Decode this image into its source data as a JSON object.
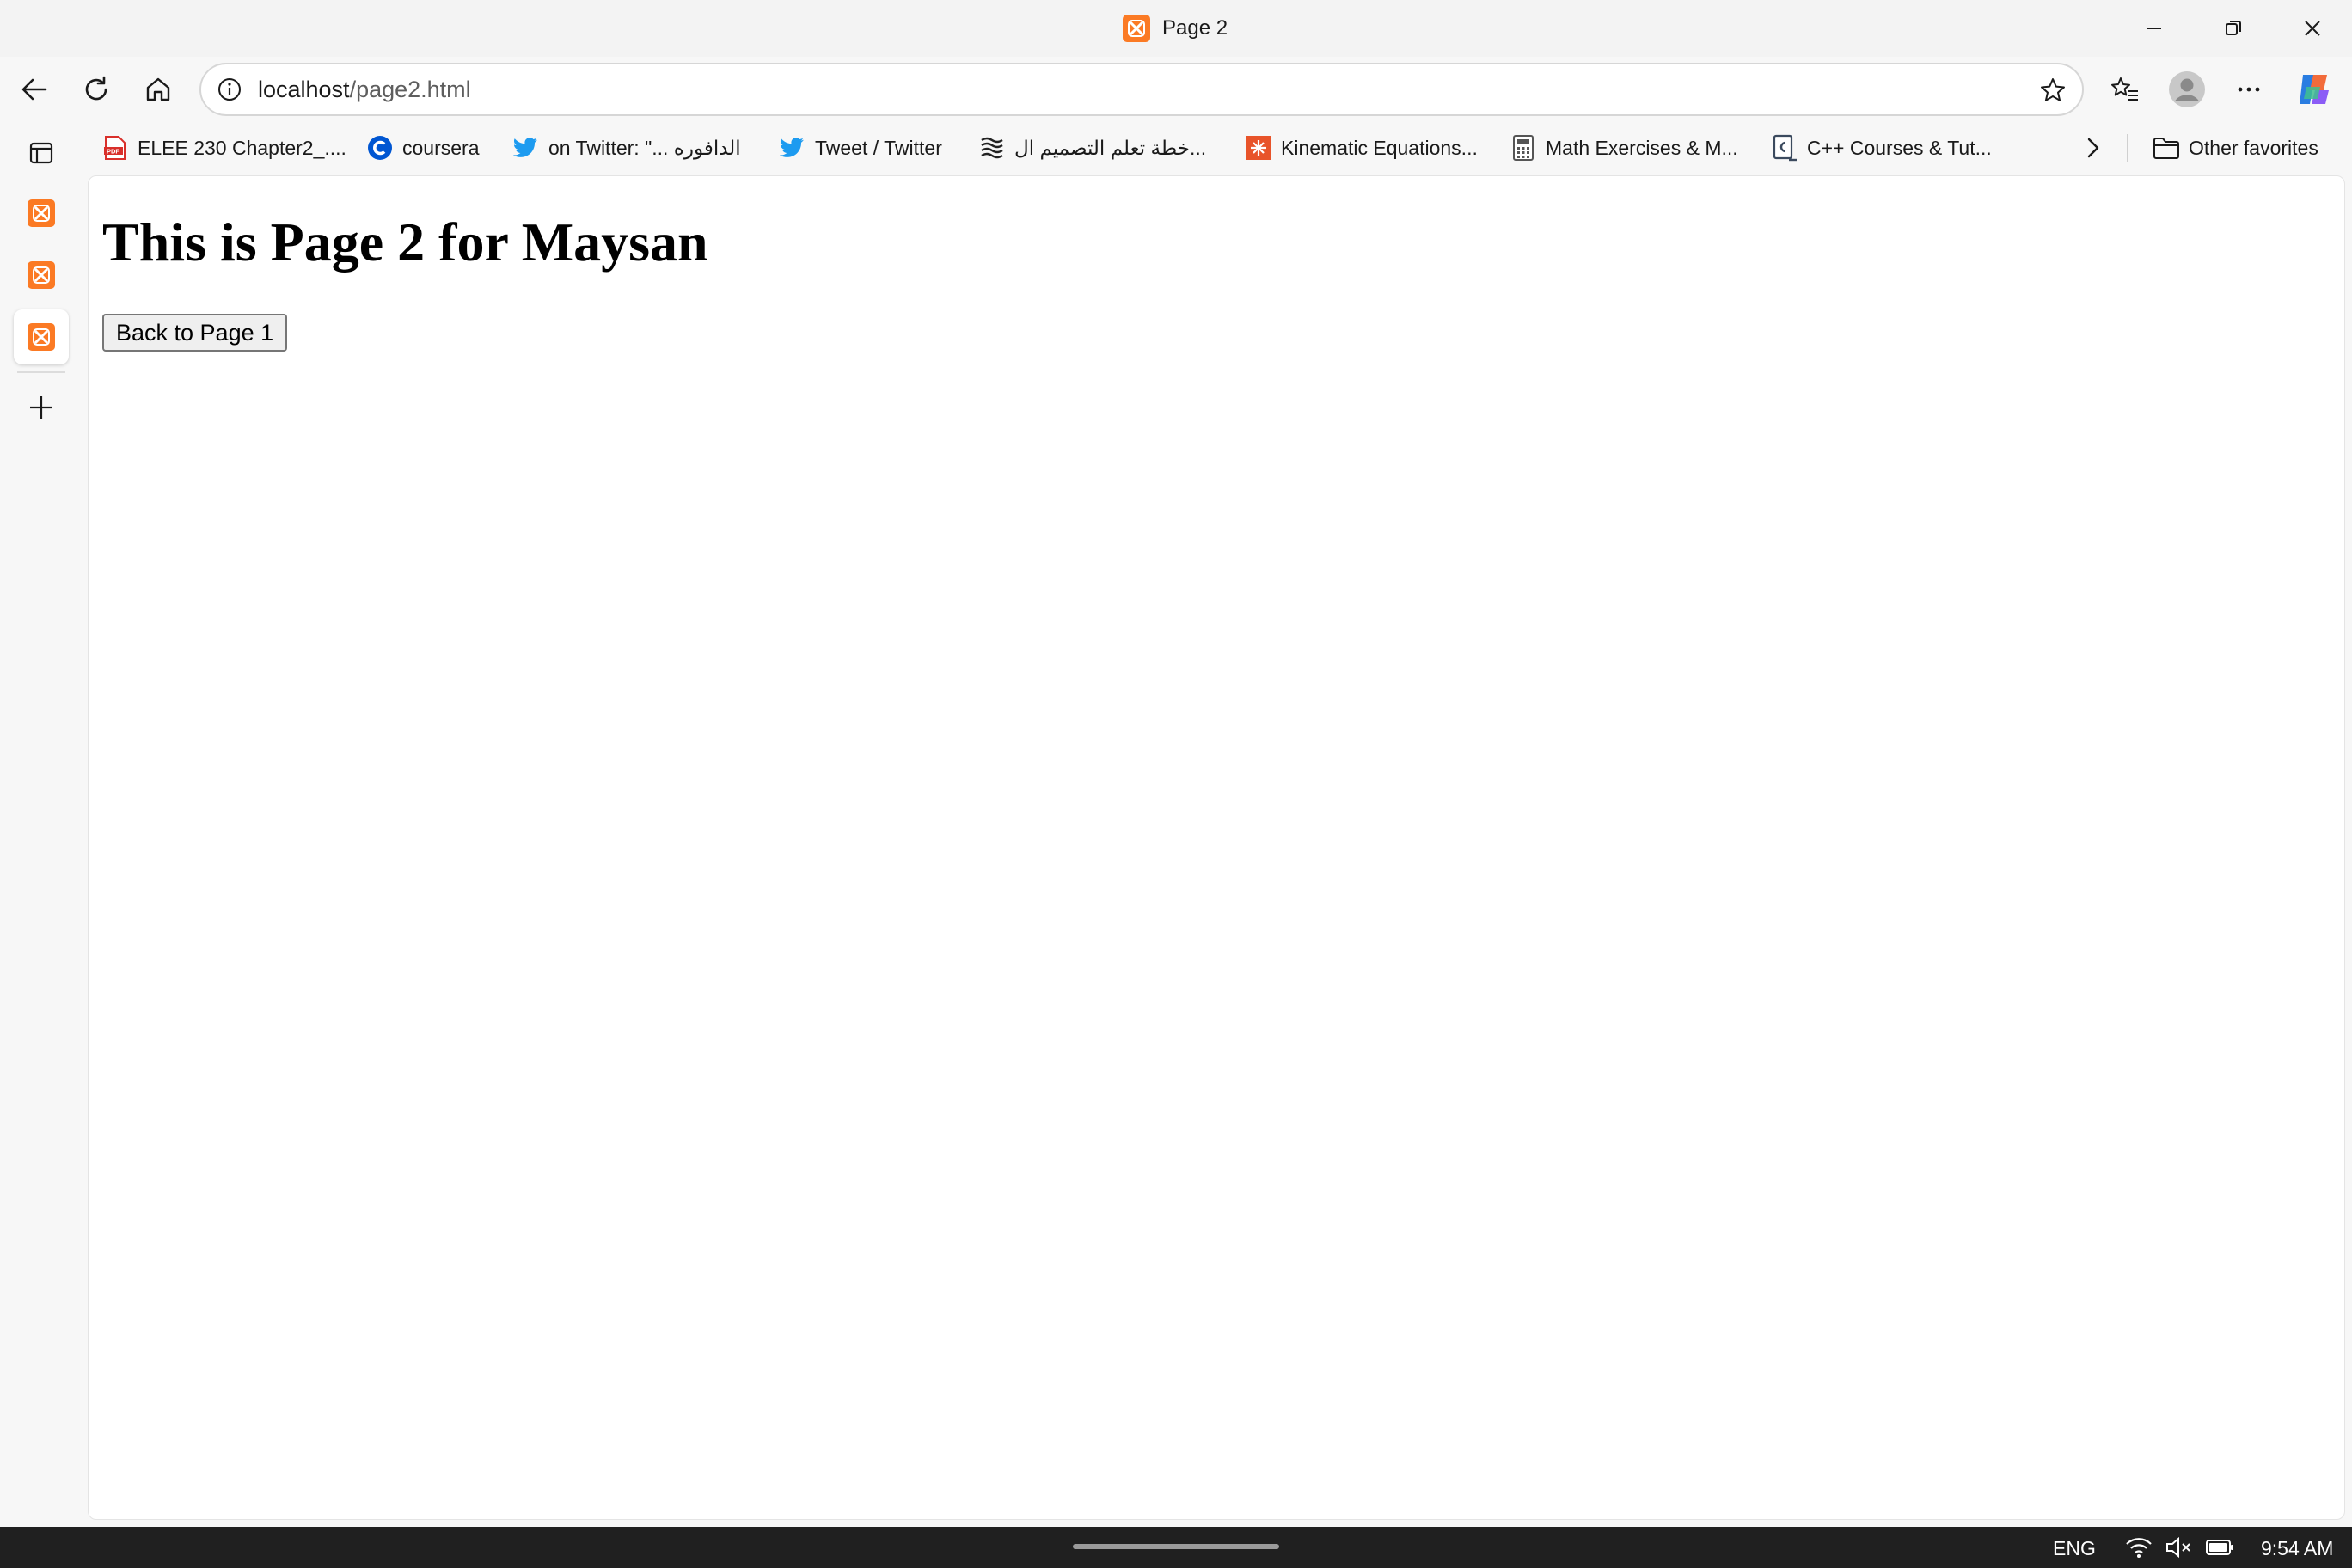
{
  "window": {
    "title": "Page 2",
    "controls": {
      "minimize": "minimize-icon",
      "restore": "restore-icon",
      "close": "close-icon"
    }
  },
  "nav": {
    "url_host": "localhost",
    "url_path": "/page2.html",
    "icons": [
      "back-icon",
      "refresh-icon",
      "home-icon",
      "site-info-icon",
      "favorite-star-icon",
      "favorites-icon",
      "profile-icon",
      "more-icon",
      "copilot-icon"
    ]
  },
  "favorites": {
    "items": [
      {
        "label": "ELEE 230 Chapter2_....",
        "icon": "pdf-icon"
      },
      {
        "label": "coursera",
        "icon": "coursera-icon"
      },
      {
        "label": "on Twitter: \"... الدافوره",
        "icon": "twitter-icon"
      },
      {
        "label": "Tweet / Twitter",
        "icon": "twitter-icon"
      },
      {
        "label": "خطة تعلم التصميم ال...",
        "icon": "pattern-icon"
      },
      {
        "label": "Kinematic Equations...",
        "icon": "kinematics-icon"
      },
      {
        "label": "Math Exercises & M...",
        "icon": "calculator-icon"
      },
      {
        "label": "C++ Courses & Tut...",
        "icon": "cpp-icon"
      }
    ],
    "other_label": "Other favorites"
  },
  "sidebar": {
    "tabs": [
      "xampp-tab-1",
      "xampp-tab-2",
      "xampp-tab-3"
    ],
    "active_index": 2
  },
  "page": {
    "heading": "This is Page 2 for Maysan",
    "button_label": "Back to Page 1"
  },
  "taskbar": {
    "language": "ENG",
    "time": "9:54 AM"
  },
  "colors": {
    "xampp_orange": "#fb7a24",
    "twitter_blue": "#1d9bf0",
    "coursera_blue": "#0056d2",
    "pdf_red": "#d9302b"
  }
}
